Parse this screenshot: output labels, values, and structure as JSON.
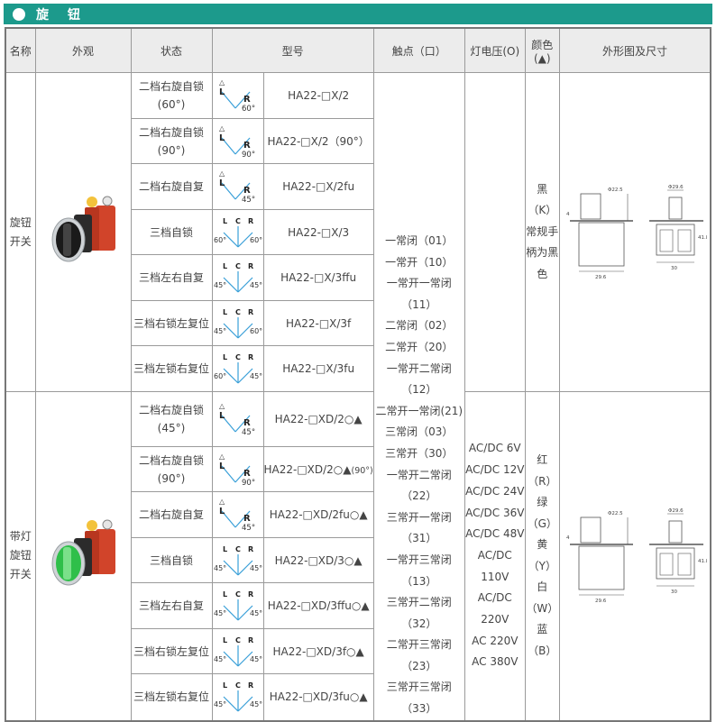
{
  "banner": {
    "title": "旋 钮"
  },
  "header": {
    "name": "名称",
    "appearance": "外观",
    "state": "状态",
    "model": "型号",
    "contacts": "触点（口）",
    "voltage": "灯电压(O)",
    "color_l1": "颜色",
    "color_l2": "(▲)",
    "dims": "外形图及尺寸"
  },
  "groups": [
    {
      "name_lines": [
        "旋钮",
        "开关"
      ],
      "rows": [
        {
          "state": [
            "二档右旋自锁",
            "(60°)"
          ],
          "model": "HA22-□X/2",
          "diagram": {
            "kind": "2",
            "angle_text": "60°"
          }
        },
        {
          "state": [
            "二档右旋自锁",
            "(90°)"
          ],
          "model": "HA22-□X/2（90°）",
          "diagram": {
            "kind": "2",
            "angle_text": "90°"
          }
        },
        {
          "state": [
            "二档右旋自复"
          ],
          "model": "HA22-□X/2fu",
          "diagram": {
            "kind": "2",
            "angle_text": "45°"
          }
        },
        {
          "state": [
            "三档自锁"
          ],
          "model": "HA22-□X/3",
          "diagram": {
            "kind": "3",
            "left_text": "60°",
            "right_text": "60°"
          }
        },
        {
          "state": [
            "三档左右自复"
          ],
          "model": "HA22-□X/3ffu",
          "diagram": {
            "kind": "3",
            "left_text": "45°",
            "right_text": "45°"
          }
        },
        {
          "state": [
            "三档右锁左复位"
          ],
          "model": "HA22-□X/3f",
          "diagram": {
            "kind": "3",
            "left_text": "45°",
            "right_text": "60°"
          }
        },
        {
          "state": [
            "三档左锁右复位"
          ],
          "model": "HA22-□X/3fu",
          "diagram": {
            "kind": "3",
            "left_text": "60°",
            "right_text": "45°"
          }
        }
      ]
    },
    {
      "name_lines": [
        "带灯",
        "旋钮",
        "开关"
      ],
      "rows": [
        {
          "state": [
            "二档右旋自锁",
            "(45°)"
          ],
          "model": "HA22-□XD/2○▲",
          "diagram": {
            "kind": "2",
            "angle_text": "45°"
          }
        },
        {
          "state": [
            "二档右旋自锁",
            "(90°)"
          ],
          "model": "HA22-□XD/2○▲",
          "model_suffix": "(90°)",
          "diagram": {
            "kind": "2",
            "angle_text": "90°"
          }
        },
        {
          "state": [
            "二档右旋自复"
          ],
          "model": "HA22-□XD/2fu○▲",
          "diagram": {
            "kind": "2",
            "angle_text": "45°"
          }
        },
        {
          "state": [
            "三档自锁"
          ],
          "model": "HA22-□XD/3○▲",
          "diagram": {
            "kind": "3",
            "left_text": "45°",
            "right_text": "45°"
          }
        },
        {
          "state": [
            "三档左右自复"
          ],
          "model": "HA22-□XD/3ffu○▲",
          "diagram": {
            "kind": "3",
            "left_text": "45°",
            "right_text": "45°"
          }
        },
        {
          "state": [
            "三档右锁左复位"
          ],
          "model": "HA22-□XD/3f○▲",
          "diagram": {
            "kind": "3",
            "left_text": "45°",
            "right_text": "45°"
          }
        },
        {
          "state": [
            "三档左锁右复位"
          ],
          "model": "HA22-□XD/3fu○▲",
          "diagram": {
            "kind": "3",
            "left_text": "45°",
            "right_text": "45°"
          }
        }
      ]
    }
  ],
  "diagram_labels": {
    "L": "L",
    "C": "C",
    "R": "R",
    "pointer": "△"
  },
  "contacts": [
    "一常闭（01）",
    "一常开（10）",
    "一常开一常闭（11）",
    "二常闭（02）",
    "二常开（20）",
    "一常开二常闭（12）",
    "二常开一常闭(21)",
    "三常闭（03）",
    "三常开（30）",
    "一常开二常闭（22）",
    "三常开一常闭（31）",
    "一常开三常闭（13）",
    "三常开二常闭（32）",
    "二常开三常闭（23）",
    "三常开三常闭（33）"
  ],
  "voltages": [
    "AC/DC 6V",
    "AC/DC 12V",
    "AC/DC 24V",
    "AC/DC 36V",
    "AC/DC 48V",
    "AC/DC 110V",
    "AC/DC 220V",
    "AC 220V",
    "AC 380V"
  ],
  "colors_group1": [
    "黑（K）",
    "常规手",
    "柄为黑",
    "色"
  ],
  "colors_group2": [
    "红（R）",
    "绿（G）",
    "黄（Y）",
    "白（W）",
    "蓝（B）"
  ],
  "dims_group1": {
    "labels": [
      "Φ29.6",
      "Φ22.5",
      "41.8",
      "29.6",
      "30",
      "4"
    ]
  },
  "dims_group2": {
    "labels": [
      "Φ29.6",
      "Φ22.5",
      "41.8",
      "29.6",
      "30",
      "4"
    ]
  },
  "colors_ui": {
    "banner": "#1c9a8c",
    "knob_black": "#1a1a1a",
    "knob_green": "#2fbf4a",
    "relay_red": "#d1442a"
  }
}
